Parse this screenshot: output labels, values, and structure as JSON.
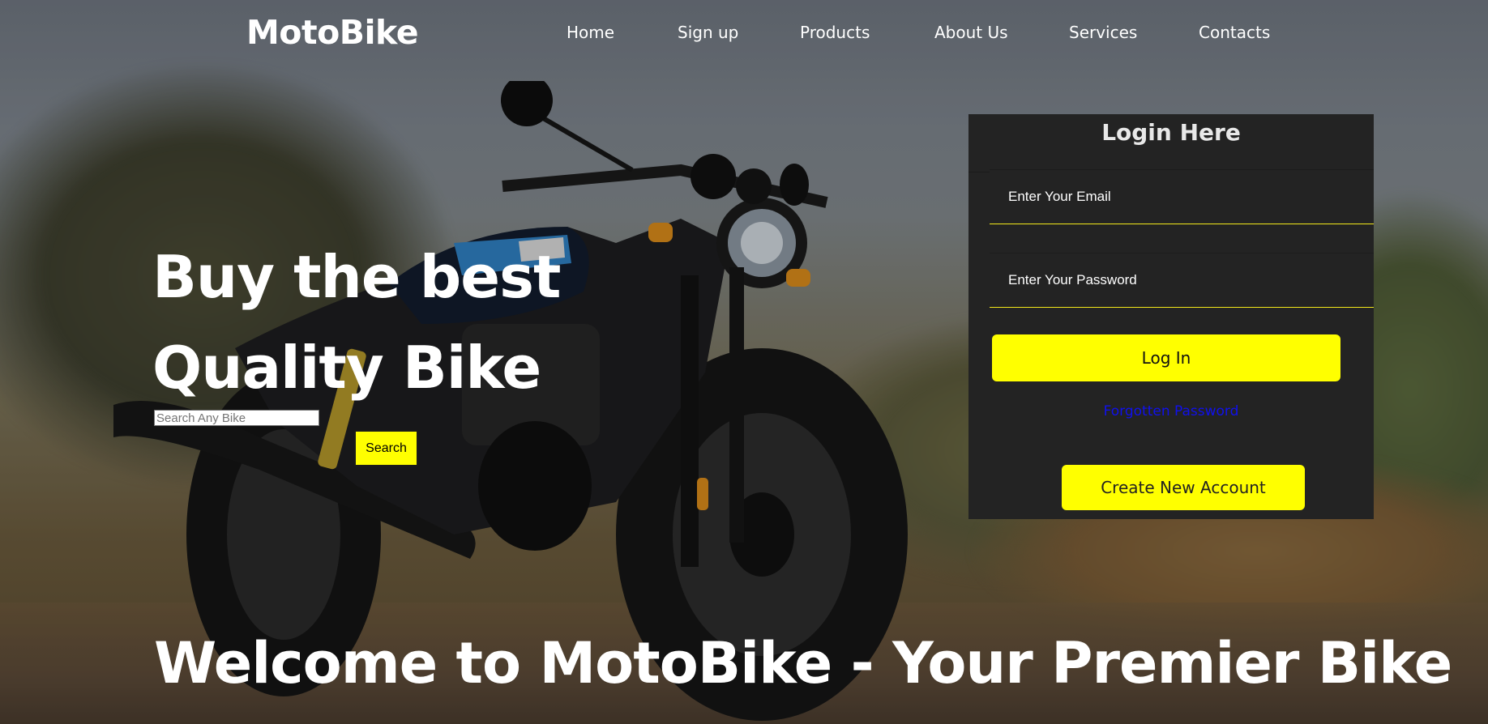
{
  "header": {
    "logo": "MotoBike",
    "nav": [
      {
        "label": "Home"
      },
      {
        "label": "Sign up"
      },
      {
        "label": "Products"
      },
      {
        "label": "About Us"
      },
      {
        "label": "Services"
      },
      {
        "label": "Contacts"
      }
    ]
  },
  "hero": {
    "title_line1": "Buy the best",
    "title_line2": "Quality Bike",
    "search_placeholder": "Search Any Bike",
    "search_button": "Search",
    "welcome": "Welcome to MotoBike - Your Premier Bike"
  },
  "login": {
    "title": "Login Here",
    "email_placeholder": "Enter Your Email",
    "password_placeholder": "Enter Your Password",
    "login_button": "Log In",
    "forgot_link": "Forgotten Password",
    "create_account_button": "Create New Account"
  },
  "colors": {
    "accent": "#ffff00",
    "panel": "#232323",
    "link": "#1010ee"
  }
}
